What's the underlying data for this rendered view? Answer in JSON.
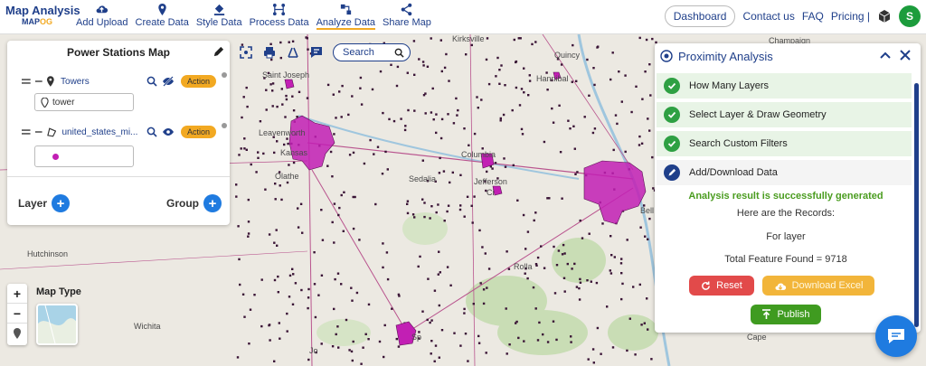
{
  "app": {
    "logo_title": "Map Analysis",
    "logo_sub_a": "MAP",
    "logo_sub_b": "OG"
  },
  "nav": [
    {
      "label": "Add Upload",
      "icon": "cloud-upload-icon"
    },
    {
      "label": "Create Data",
      "icon": "map-pin-icon"
    },
    {
      "label": "Style Data",
      "icon": "paint-bucket-icon"
    },
    {
      "label": "Process Data",
      "icon": "process-nodes-icon"
    },
    {
      "label": "Analyze Data",
      "icon": "analyze-icon"
    },
    {
      "label": "Share Map",
      "icon": "share-icon"
    }
  ],
  "nav_active": "Analyze Data",
  "topright": {
    "dashboard": "Dashboard",
    "contact": "Contact us",
    "faq": "FAQ",
    "pricing": "Pricing |",
    "avatar_letter": "S"
  },
  "map_toolbar": {
    "search_placeholder": "Search"
  },
  "layers_panel": {
    "title": "Power Stations Map",
    "layers": [
      {
        "name": "Towers",
        "action": "Action",
        "sub_value": "tower"
      },
      {
        "name": "united_states_mi...",
        "action": "Action"
      }
    ],
    "layer_label": "Layer",
    "group_label": "Group"
  },
  "map_controls": {
    "zoom_in": "+",
    "zoom_out": "−",
    "map_type_label": "Map Type"
  },
  "place_labels": {
    "kirksville": "Kirksville",
    "champaign": "Champaign",
    "saint_joseph": "Saint Joseph",
    "hannibal": "Hannibal",
    "quincy": "Quincy",
    "leavenworth": "Leavenworth",
    "kansas": "Kansas",
    "olathe": "Olathe",
    "sedalia": "Sedalia",
    "columbia": "Columbia",
    "jefferson": "Jefferson",
    "jefferson_ci": "Ci",
    "hutchinson": "Hutchinson",
    "rolla": "Rolla",
    "springfield": "Sp",
    "bell": "Bell",
    "wichita": "Wichita",
    "joplin": "Jo",
    "cape": "Cape"
  },
  "proximity": {
    "title": "Proximity Analysis",
    "steps": [
      {
        "label": "How Many Layers",
        "state": "done"
      },
      {
        "label": "Select Layer & Draw Geometry",
        "state": "done"
      },
      {
        "label": "Search Custom Filters",
        "state": "done"
      },
      {
        "label": "Add/Download Data",
        "state": "active"
      }
    ],
    "success_msg": "Analysis result is successfully generated",
    "records_msg": "Here are the Records:",
    "for_layer": "For layer",
    "total_found": "Total Feature Found = 9718",
    "reset": "Reset",
    "download_excel": "Download Excel",
    "publish": "Publish"
  },
  "colors": {
    "brand": "#1f3f8a",
    "accent": "#f2a922",
    "feature": "#c21fb4",
    "success": "#4a9c1f"
  }
}
